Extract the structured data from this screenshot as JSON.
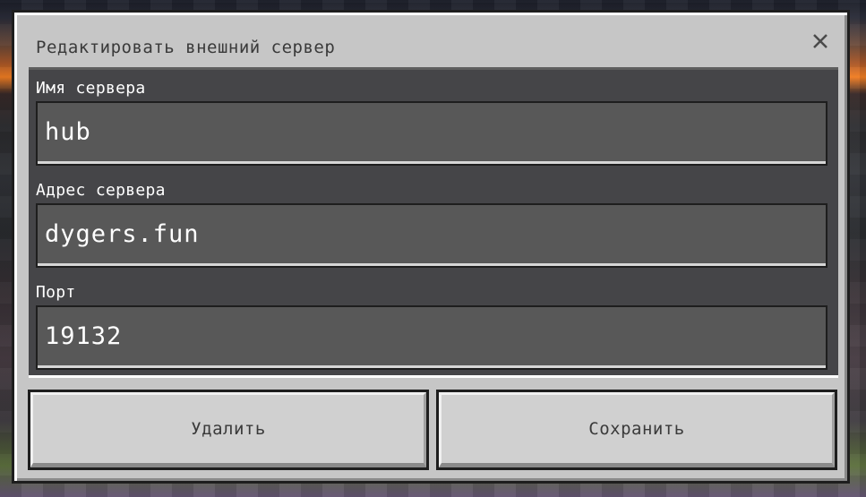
{
  "dialog": {
    "title": "Редактировать внешний сервер",
    "close_icon": "close-icon"
  },
  "fields": {
    "server_name": {
      "label": "Имя сервера",
      "value": "hub"
    },
    "server_address": {
      "label": "Адрес сервера",
      "value": "dygers.fun"
    },
    "port": {
      "label": "Порт",
      "value": "19132"
    }
  },
  "buttons": {
    "delete": "Удалить",
    "save": "Сохранить"
  }
}
